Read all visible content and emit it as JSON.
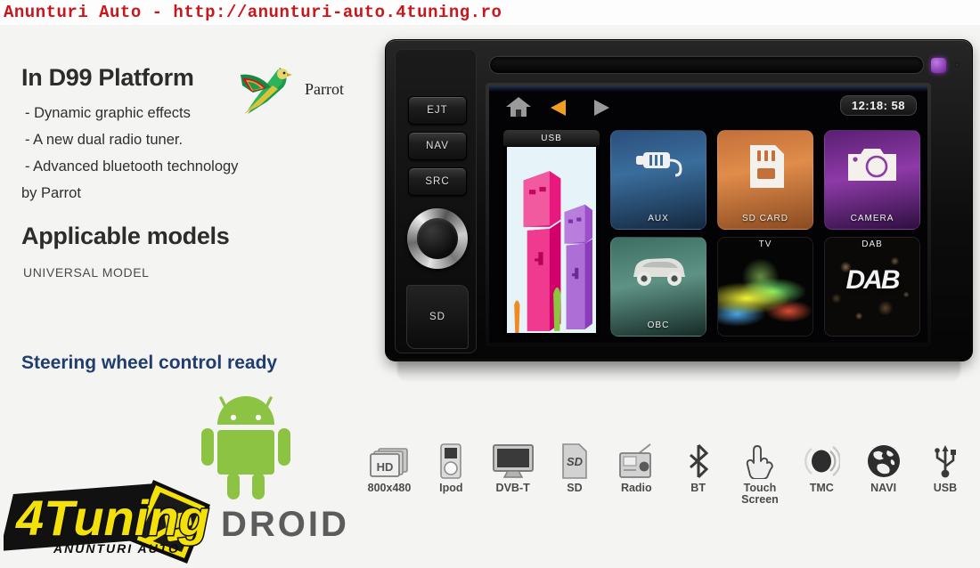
{
  "header": {
    "watermark": "Anunturi Auto - http://anunturi-auto.4tuning.ro"
  },
  "left": {
    "platform_title": "In D99 Platform",
    "parrot_brand": "Parrot",
    "parrot_logo_icon": "parrot-bird-icon",
    "features": [
      "- Dynamic graphic effects",
      "- A new dual radio tuner.",
      "- Advanced bluetooth technology",
      "by Parrot"
    ],
    "models_title": "Applicable models",
    "models_value": "UNIVERSAL  MODEL",
    "swc_text": "Steering wheel control ready",
    "swc_color": "#1f3d6e",
    "android_word": "DROID",
    "android_icon": "android-robot-icon",
    "android_color": "#8dc342",
    "logo": {
      "brand": "4Tuning",
      "tagline": "ANUNTURI AUTO",
      "color": "#f5e10a"
    }
  },
  "device": {
    "side_buttons": [
      "EJT",
      "NAV",
      "SRC"
    ],
    "knob_icon": "rotary-knob-icon",
    "sd_slot_label": "SD",
    "disc_slot_icon": "cd-slot-icon",
    "led_color": "#8e3aa8",
    "screen": {
      "home_icon": "home-icon",
      "prev_icon": "triangle-left-icon",
      "next_icon": "triangle-right-icon",
      "clock": "12:18: 58",
      "tiles": [
        {
          "id": "aux",
          "label": "AUX",
          "icon": "aux-plug-icon",
          "color": "#3a6d9c",
          "label_pos": "bottom"
        },
        {
          "id": "usb",
          "label": "USB",
          "icon": "usb-connectors-photo",
          "color": "#dff0f7",
          "label_pos": "top"
        },
        {
          "id": "sdcard",
          "label": "SD CARD",
          "icon": "sd-card-icon",
          "color": "#e08c4a",
          "label_pos": "bottom"
        },
        {
          "id": "camera",
          "label": "CAMERA",
          "icon": "camera-icon",
          "color": "#8e3aa8",
          "label_pos": "bottom"
        },
        {
          "id": "obc",
          "label": "OBC",
          "icon": "car-icon",
          "color": "#5e9284",
          "label_pos": "bottom"
        },
        {
          "id": "tv",
          "label": "TV",
          "icon": "tv-artwork",
          "color": "#050505",
          "label_pos": "top"
        },
        {
          "id": "dab",
          "label": "DAB",
          "icon": "dab-logo",
          "color": "#0b0a0a",
          "label_pos": "top",
          "art_word": "DAB"
        }
      ]
    }
  },
  "features_strip": [
    {
      "label": "800x480",
      "icon": "hd-screens-icon",
      "badge": "HD"
    },
    {
      "label": "Ipod",
      "icon": "ipod-icon"
    },
    {
      "label": "DVB-T",
      "icon": "monitor-icon"
    },
    {
      "label": "SD",
      "icon": "sd-card-icon"
    },
    {
      "label": "Radio",
      "icon": "radio-icon"
    },
    {
      "label": "BT",
      "icon": "bluetooth-icon"
    },
    {
      "label": "Touch\nScreen",
      "icon": "hand-pointer-icon"
    },
    {
      "label": "TMC",
      "icon": "tmc-signal-icon"
    },
    {
      "label": "NAVI",
      "icon": "globe-icon"
    },
    {
      "label": "USB",
      "icon": "usb-icon"
    }
  ]
}
